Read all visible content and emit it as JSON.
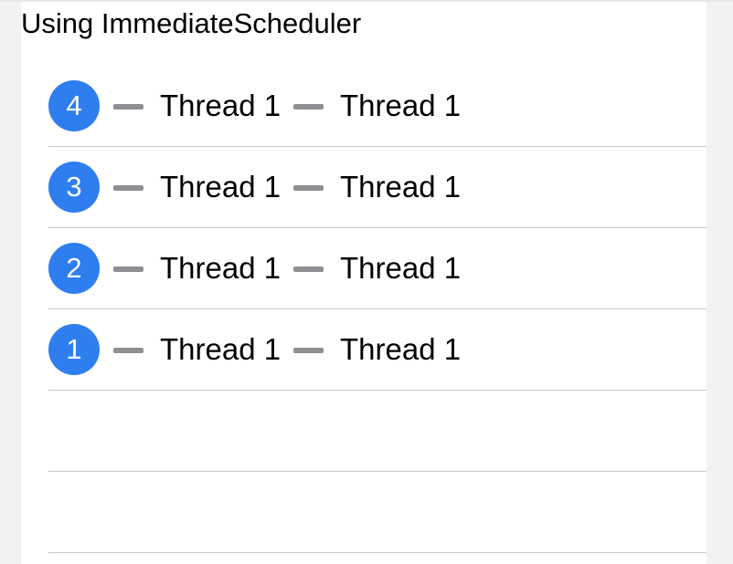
{
  "title": "Using ImmediateScheduler",
  "rows": [
    {
      "badge": "4",
      "first": "Thread 1",
      "second": "Thread 1"
    },
    {
      "badge": "3",
      "first": "Thread 1",
      "second": "Thread 1"
    },
    {
      "badge": "2",
      "first": "Thread 1",
      "second": "Thread 1"
    },
    {
      "badge": "1",
      "first": "Thread 1",
      "second": "Thread 1"
    },
    {
      "badge": "",
      "first": "",
      "second": ""
    },
    {
      "badge": "",
      "first": "",
      "second": ""
    }
  ],
  "colors": {
    "badge": "#2f7ef0",
    "dash": "#8e8e93",
    "separator": "#c9c9cc",
    "background": "#ffffff",
    "gutter": "#f2f2f4"
  },
  "icons": {
    "dash": "dash-icon"
  }
}
